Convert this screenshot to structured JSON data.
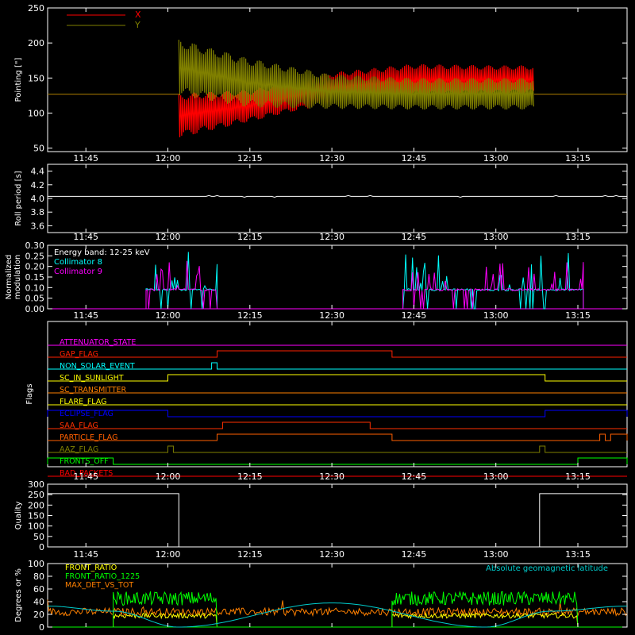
{
  "colors": {
    "background": "#000000",
    "axis": "#ffffff",
    "x_series": "#ff0000",
    "y_series": "#808000",
    "collimator_8": "#00ffff",
    "collimator_9": "#ff00ff",
    "front_ratio": "#ffff00",
    "front_ratio_1225": "#00ff00",
    "max_det_vs_tot": "#ff8000",
    "geomag": "#00cccc"
  },
  "chart_data": [
    {
      "id": "pointing",
      "type": "line",
      "ylabel": "Pointing [\"]",
      "xlim": [
        "11:38",
        "13:24"
      ],
      "ylim": [
        45,
        250
      ],
      "xticks": [
        "11:45",
        "12:00",
        "12:15",
        "12:30",
        "12:45",
        "13:00",
        "13:15"
      ],
      "yticks": [
        50,
        100,
        150,
        200,
        250
      ],
      "legend_position": "top-left",
      "series": [
        {
          "name": "X",
          "baseline": 127,
          "active_start": "12:02",
          "active_end": "13:07",
          "band": [
            {
              "t": "12:02",
              "min": 65,
              "max": 128
            },
            {
              "t": "12:15",
              "min": 88,
              "max": 133
            },
            {
              "t": "12:30",
              "min": 115,
              "max": 158
            },
            {
              "t": "12:45",
              "min": 124,
              "max": 170
            },
            {
              "t": "13:00",
              "min": 127,
              "max": 168
            },
            {
              "t": "13:07",
              "min": 128,
              "max": 168
            }
          ]
        },
        {
          "name": "Y",
          "baseline": 127,
          "active_start": "12:02",
          "active_end": "13:07",
          "band": [
            {
              "t": "12:02",
              "min": 125,
              "max": 205
            },
            {
              "t": "12:15",
              "min": 108,
              "max": 178
            },
            {
              "t": "12:30",
              "min": 106,
              "max": 155
            },
            {
              "t": "12:45",
              "min": 105,
              "max": 150
            },
            {
              "t": "13:00",
              "min": 105,
              "max": 150
            },
            {
              "t": "13:07",
              "min": 105,
              "max": 150
            }
          ]
        }
      ]
    },
    {
      "id": "roll",
      "type": "line",
      "ylabel": "Roll period [s]",
      "xlim": [
        "11:38",
        "13:24"
      ],
      "ylim": [
        3.5,
        4.5
      ],
      "xticks": [
        "11:45",
        "12:00",
        "12:15",
        "12:30",
        "12:45",
        "13:00",
        "13:15"
      ],
      "yticks": [
        "3.6",
        "3.8",
        "4.0",
        "4.2",
        "4.4"
      ],
      "series": [
        {
          "value": 4.03,
          "active_start": "11:38",
          "active_end": "13:24"
        }
      ]
    },
    {
      "id": "modulation",
      "type": "line",
      "ylabel": "Normalized modulation",
      "xlim": [
        "11:38",
        "13:24"
      ],
      "ylim": [
        0,
        0.3
      ],
      "xticks": [
        "11:45",
        "12:00",
        "12:15",
        "12:30",
        "12:45",
        "13:00",
        "13:15"
      ],
      "yticks": [
        "0.00",
        "0.05",
        "0.10",
        "0.15",
        "0.20",
        "0.25",
        "0.30"
      ],
      "annotation": "Energy band: 12-25 keV",
      "segments": [
        [
          "11:56",
          "12:09"
        ],
        [
          "12:43",
          "13:16"
        ]
      ],
      "series": [
        {
          "name": "Collimator 8",
          "typical": 0.09,
          "peak": 0.27
        },
        {
          "name": "Collimator 9",
          "typical": 0.09,
          "peak": 0.23
        }
      ]
    },
    {
      "id": "flags",
      "type": "line",
      "ylabel": "Flags",
      "xlim": [
        "11:38",
        "13:24"
      ],
      "flags": [
        {
          "name": "ATTENUATOR_STATE",
          "color": "#ff00ff",
          "high_intervals": []
        },
        {
          "name": "GAP_FLAG",
          "color": "#ff2000",
          "high_intervals": [
            [
              "12:09",
              "12:41"
            ]
          ]
        },
        {
          "name": "NON_SOLAR_EVENT",
          "color": "#00ffff",
          "high_intervals": [
            [
              "12:08",
              "12:09"
            ]
          ]
        },
        {
          "name": "SC_IN_SUNLIGHT",
          "color": "#ffff00",
          "high_intervals": [
            [
              "12:00",
              "13:09"
            ]
          ]
        },
        {
          "name": "SC_TRANSMITTER",
          "color": "#ff8000",
          "high_intervals": []
        },
        {
          "name": "FLARE_FLAG",
          "color": "#ffff00",
          "high_intervals": []
        },
        {
          "name": "ECLIPSE_FLAG",
          "color": "#0000ff",
          "high_intervals": [
            [
              "11:38",
              "12:00"
            ],
            [
              "13:09",
              "13:24"
            ]
          ]
        },
        {
          "name": "SAA_FLAG",
          "color": "#ff3000",
          "high_intervals": [
            [
              "12:10",
              "12:37"
            ]
          ]
        },
        {
          "name": "PARTICLE_FLAG",
          "color": "#ff6000",
          "high_intervals": [
            [
              "12:09",
              "12:41"
            ],
            [
              "13:19",
              "13:20"
            ],
            [
              "13:21",
              "13:24"
            ]
          ]
        },
        {
          "name": "AAZ_FLAG",
          "color": "#808000",
          "high_intervals": [
            [
              "12:00",
              "12:01"
            ],
            [
              "13:08",
              "13:09"
            ]
          ]
        },
        {
          "name": "FRONTS_OFF",
          "color": "#00ff00",
          "high_intervals": [
            [
              "11:38",
              "11:50"
            ],
            [
              "13:15",
              "13:24"
            ]
          ]
        },
        {
          "name": "BAD_PACKETS",
          "color": "#ff0000",
          "high_intervals": []
        }
      ]
    },
    {
      "id": "quality",
      "type": "line",
      "ylabel": "Quality",
      "xlim": [
        "11:38",
        "13:24"
      ],
      "ylim": [
        0,
        300
      ],
      "xticks": [
        "11:45",
        "12:00",
        "12:15",
        "12:30",
        "12:45",
        "13:00",
        "13:15"
      ],
      "yticks": [
        0,
        50,
        100,
        150,
        200,
        250,
        300
      ],
      "series": [
        {
          "points": [
            [
              "11:38",
              255
            ],
            [
              "12:02",
              255
            ],
            [
              "12:02",
              0
            ],
            [
              "13:08",
              0
            ],
            [
              "13:08",
              255
            ],
            [
              "13:24",
              255
            ]
          ]
        }
      ]
    },
    {
      "id": "ratios",
      "type": "line",
      "ylabel": "Degrees or %",
      "xlim": [
        "11:38",
        "13:24"
      ],
      "ylim": [
        0,
        100
      ],
      "yticks": [
        0,
        20,
        40,
        60,
        80,
        100
      ],
      "segments": [
        [
          "11:50",
          "12:09"
        ],
        [
          "12:41",
          "13:15"
        ]
      ],
      "series": [
        {
          "name": "FRONT_RATIO",
          "typical": 18
        },
        {
          "name": "FRONT_RATIO_1225",
          "typical": 45
        },
        {
          "name": "MAX_DET_VS_TOT",
          "typical": 24
        },
        {
          "name": "Absolute geomagnetic latitude",
          "points": [
            [
              "11:38",
              33
            ],
            [
              "11:50",
              25
            ],
            [
              "12:02",
              0
            ],
            [
              "12:30",
              38
            ],
            [
              "12:58",
              0
            ],
            [
              "13:10",
              25
            ],
            [
              "13:24",
              33
            ]
          ]
        }
      ]
    }
  ]
}
